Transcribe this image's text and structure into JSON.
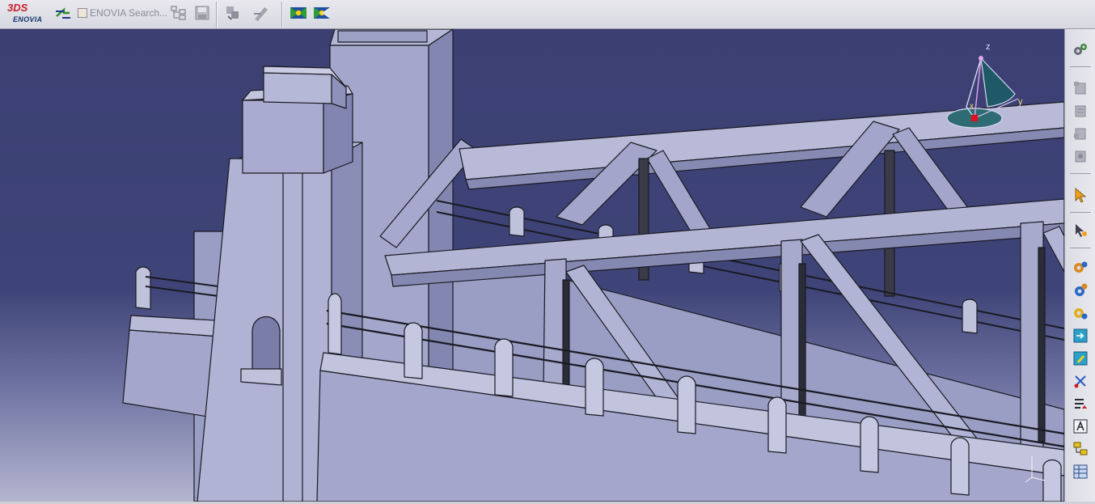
{
  "app": {
    "logo_top": "3DS",
    "logo_bottom": "ENOVIA"
  },
  "toolbar": {
    "search_label": "ENOVIA Search...",
    "icons": [
      "enovia-connect-icon",
      "search-checkbox",
      "search-tree-icon",
      "save-icon",
      "part-swap-icon",
      "rename-icon",
      "view-icon-1",
      "view-icon-2"
    ]
  },
  "compass": {
    "axis_x": "x",
    "axis_y": "y",
    "axis_z": "z"
  },
  "right_toolbar": {
    "icons": [
      "gear-settings-icon",
      "view-icon-1",
      "view-icon-2",
      "view-icon-3",
      "view-icon-4",
      "select-arrow-icon",
      "multi-select-icon",
      "gears-icon-1",
      "gears-icon-2",
      "gears-icon-3",
      "insert-icon",
      "edit-icon",
      "cut-icon",
      "sort-icon",
      "text-a-icon",
      "tree-icon",
      "table-icon"
    ]
  },
  "colors": {
    "background_top": "#3b3f72",
    "model_fill": "#a8aace",
    "model_shadow": "#7e81ad",
    "edge": "#1a1a22"
  }
}
